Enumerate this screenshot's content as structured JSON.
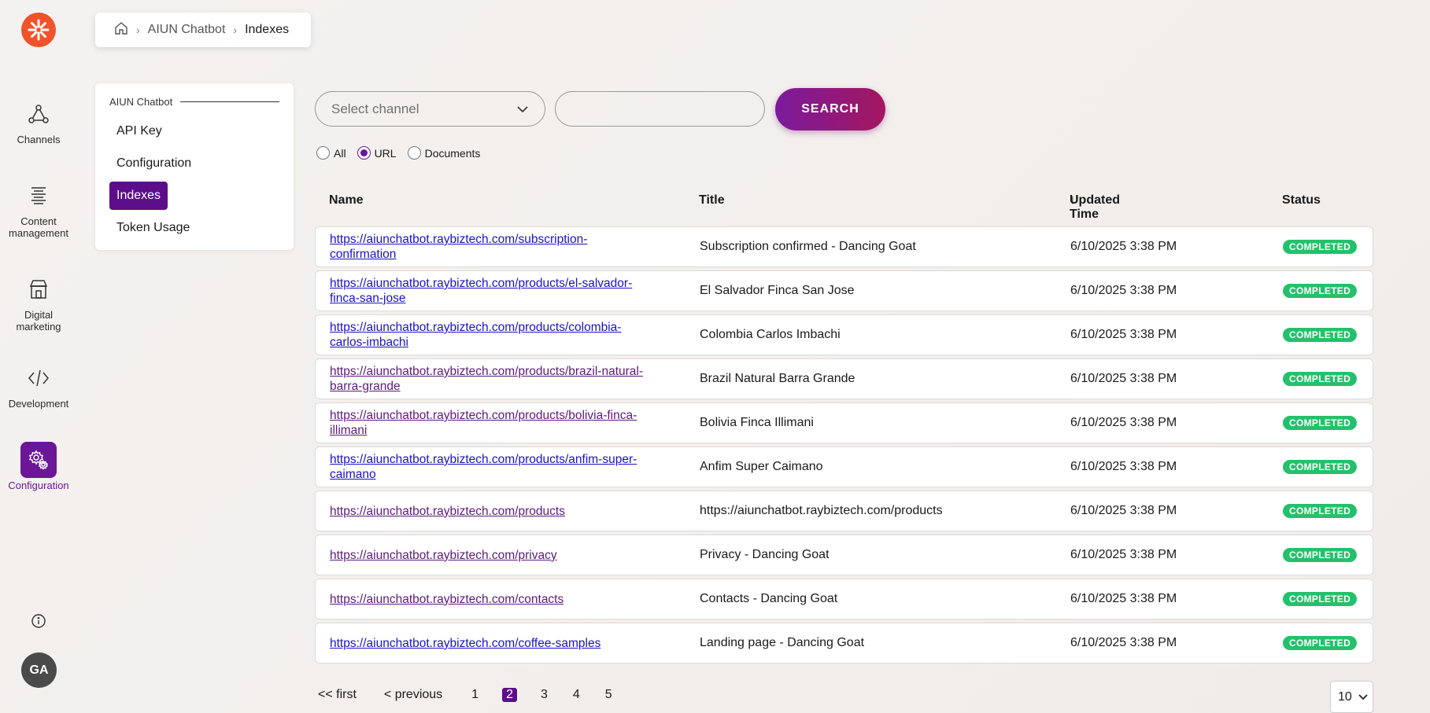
{
  "rail": {
    "items": [
      {
        "label": "Channels",
        "icon": "channels-icon"
      },
      {
        "label": "Content management",
        "icon": "content-management-icon"
      },
      {
        "label": "Digital marketing",
        "icon": "digital-marketing-icon"
      },
      {
        "label": "Development",
        "icon": "code-icon"
      },
      {
        "label": "Configuration",
        "icon": "gear-icon"
      }
    ],
    "avatar": "GA",
    "accent": "#6b1696",
    "logo_color": "#f0532b"
  },
  "breadcrumb": {
    "items": [
      "AIUN Chatbot",
      "Indexes"
    ]
  },
  "submenu": {
    "heading": "AIUN Chatbot",
    "items": [
      "API Key",
      "Configuration",
      "Indexes",
      "Token Usage"
    ],
    "active": "Indexes"
  },
  "filters": {
    "channel_placeholder": "Select channel",
    "search_label": "SEARCH",
    "radios": [
      "All",
      "URL",
      "Documents"
    ],
    "selected_radio": "URL"
  },
  "table": {
    "headers": {
      "name": "Name",
      "title": "Title",
      "updated": "Updated Time",
      "sort_arrow": "↓",
      "status": "Status"
    },
    "rows": [
      {
        "name": "https://aiunchatbot.raybiztech.com/subscription-confirmation",
        "name_l1": "https://aiunchatbot.raybiztech.com/subscription-",
        "name_l2": "confirmation",
        "title": "Subscription confirmed - Dancing Goat",
        "updated": "6/10/2025 3:38 PM",
        "status": "COMPLETED"
      },
      {
        "name": "https://aiunchatbot.raybiztech.com/products/el-salvador-finca-san-jose",
        "name_l1": "https://aiunchatbot.raybiztech.com/products/el-salvador-",
        "name_l2": "finca-san-jose",
        "title": "El Salvador Finca San Jose",
        "updated": "6/10/2025 3:38 PM",
        "status": "COMPLETED"
      },
      {
        "name": "https://aiunchatbot.raybiztech.com/products/colombia-carlos-imbachi",
        "name_l1": "https://aiunchatbot.raybiztech.com/products/colombia-",
        "name_l2": "carlos-imbachi",
        "title": "Colombia Carlos Imbachi",
        "updated": "6/10/2025 3:38 PM",
        "status": "COMPLETED"
      },
      {
        "name": "https://aiunchatbot.raybiztech.com/products/brazil-natural-barra-grande",
        "name_l1": "https://aiunchatbot.raybiztech.com/products/brazil-natural-",
        "name_l2": "barra-grande",
        "title": "Brazil Natural Barra Grande",
        "updated": "6/10/2025 3:38 PM",
        "status": "COMPLETED"
      },
      {
        "name": "https://aiunchatbot.raybiztech.com/products/bolivia-finca-illimani",
        "name_l1": "https://aiunchatbot.raybiztech.com/products/bolivia-finca-",
        "name_l2": "illimani",
        "title": "Bolivia Finca Illimani",
        "updated": "6/10/2025 3:38 PM",
        "status": "COMPLETED"
      },
      {
        "name": "https://aiunchatbot.raybiztech.com/products/anfim-super-caimano",
        "name_l1": "https://aiunchatbot.raybiztech.com/products/anfim-super-",
        "name_l2": "caimano",
        "title": "Anfim Super Caimano",
        "updated": "6/10/2025 3:38 PM",
        "status": "COMPLETED"
      },
      {
        "name": "https://aiunchatbot.raybiztech.com/products",
        "name_l1": "https://aiunchatbot.raybiztech.com/products",
        "name_l2": "",
        "title": "https://aiunchatbot.raybiztech.com/products",
        "updated": "6/10/2025 3:38 PM",
        "status": "COMPLETED"
      },
      {
        "name": "https://aiunchatbot.raybiztech.com/privacy",
        "name_l1": "https://aiunchatbot.raybiztech.com/privacy",
        "name_l2": "",
        "title": "Privacy - Dancing Goat",
        "updated": "6/10/2025 3:38 PM",
        "status": "COMPLETED"
      },
      {
        "name": "https://aiunchatbot.raybiztech.com/contacts",
        "name_l1": "https://aiunchatbot.raybiztech.com/contacts",
        "name_l2": "",
        "title": "Contacts - Dancing Goat",
        "updated": "6/10/2025 3:38 PM",
        "status": "COMPLETED"
      },
      {
        "name": "https://aiunchatbot.raybiztech.com/coffee-samples",
        "name_l1": "https://aiunchatbot.raybiztech.com/coffee-samples",
        "name_l2": "",
        "title": "Landing page - Dancing Goat",
        "updated": "6/10/2025 3:38 PM",
        "status": "COMPLETED"
      }
    ],
    "status_color": "#23c16b"
  },
  "pagination": {
    "first": "<< first",
    "previous": "< previous",
    "pages": [
      "1",
      "2",
      "3",
      "4",
      "5"
    ],
    "current": "2",
    "page_size": "10"
  }
}
